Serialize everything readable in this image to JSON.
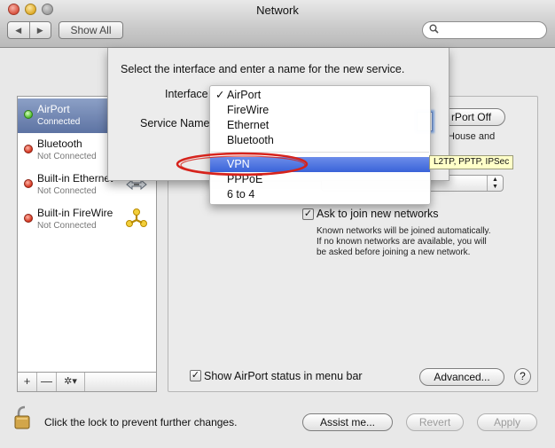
{
  "window": {
    "title": "Network",
    "nav_back": "◀",
    "nav_forward": "▶",
    "show_all": "Show All",
    "search_placeholder": ""
  },
  "sidebar": {
    "items": [
      {
        "name": "AirPort",
        "status": "Connected",
        "indicator": "green",
        "icon": "wifi-icon"
      },
      {
        "name": "Bluetooth",
        "status": "Not Connected",
        "indicator": "red",
        "icon": "bluetooth-icon"
      },
      {
        "name": "Built-in Ethernet",
        "status": "Not Connected",
        "indicator": "red",
        "icon": "ethernet-icon"
      },
      {
        "name": "Built-in FireWire",
        "status": "Not Connected",
        "indicator": "red",
        "icon": "firewire-icon"
      }
    ],
    "add": "+",
    "remove": "—",
    "action": "✲▾"
  },
  "sheet": {
    "prompt": "Select the interface and enter a name for the new service.",
    "interface_label": "Interface",
    "service_name_label": "Service Name"
  },
  "interface_menu": {
    "checked": "✓",
    "items_group1": [
      "AirPort",
      "FireWire",
      "Ethernet",
      "Bluetooth"
    ],
    "items_group2": [
      "VPN",
      "PPPoE",
      "6 to 4"
    ],
    "highlighted": "VPN",
    "tooltip": "L2TP, PPTP, IPSec"
  },
  "panel": {
    "turn_airport_off": "rPort Off",
    "house_and_text": "House and",
    "ask_join_label": "Ask to join new networks",
    "ask_join_checked": true,
    "ask_join_help": [
      "Known networks will be joined automatically.",
      "If no known networks are available, you will",
      "be asked before joining a new network."
    ],
    "show_status_label": "Show AirPort status in menu bar",
    "show_status_checked": true,
    "advanced": "Advanced...",
    "help": "?"
  },
  "footer": {
    "lock_text": "Click the lock to prevent further changes.",
    "assist": "Assist me...",
    "revert": "Revert",
    "apply": "Apply"
  },
  "colors": {
    "selection": "#5d73a3",
    "menu_highlight": "#3a63d9",
    "annotation": "#d6231c"
  }
}
